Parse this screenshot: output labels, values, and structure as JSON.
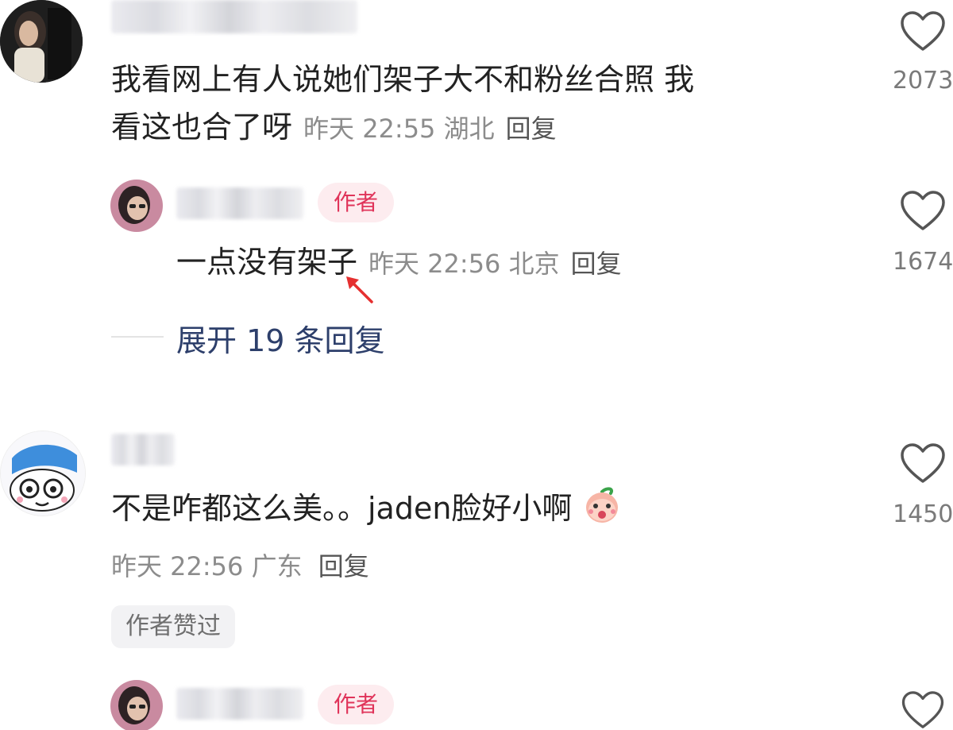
{
  "comments": [
    {
      "text": "我看网上有人说她们架子大不和粉丝合照 我",
      "text_line2": "看这也合了呀",
      "meta": "昨天 22:55 湖北",
      "reply_label": "回复",
      "likes": "2073"
    },
    {
      "tag": "作者",
      "text": "一点没有架子",
      "meta": "昨天 22:56 北京",
      "reply_label": "回复",
      "likes": "1674",
      "expand_label": "展开 19 条回复"
    },
    {
      "text": "不是咋都这么美。。jaden脸好小啊",
      "meta": "昨天 22:56 广东",
      "reply_label": "回复",
      "likes": "1450",
      "liked_badge": "作者赞过"
    },
    {
      "tag": "作者"
    }
  ],
  "icons": {
    "like": "heart-outline-icon",
    "emoji": "peach-face-emoji",
    "annotation": "red-arrow"
  },
  "colors": {
    "author_tag_bg": "#fdecef",
    "author_tag_text": "#e0345a",
    "expand_text": "#2d3f6b",
    "arrow": "#e53030"
  }
}
